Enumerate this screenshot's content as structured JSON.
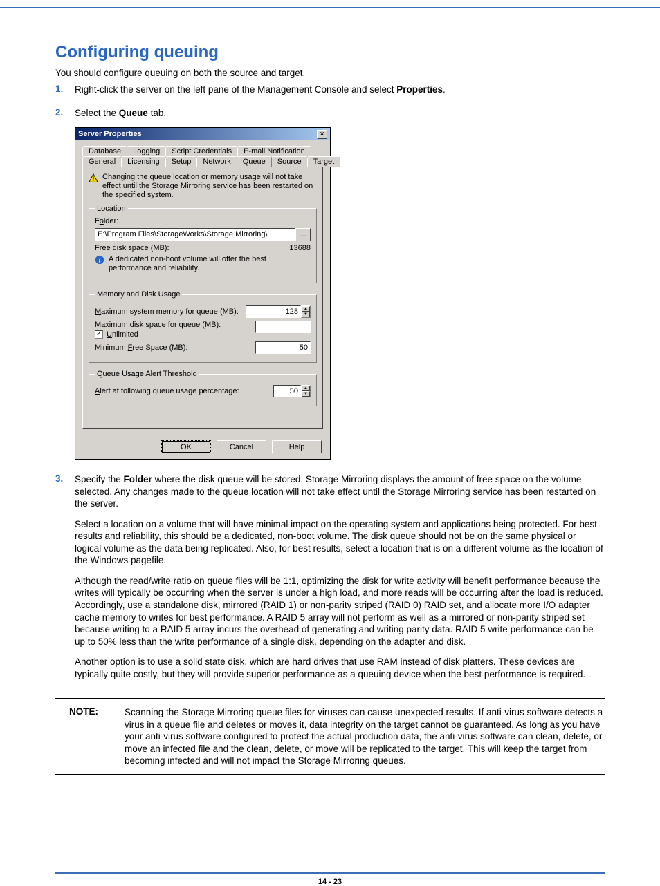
{
  "heading": "Configuring queuing",
  "intro": "You should configure queuing on both the source and target.",
  "steps": {
    "s1": {
      "prefix": "Right-click the server on the left pane of the Management Console and select ",
      "bold": "Properties",
      "suffix": "."
    },
    "s2": {
      "prefix": "Select the ",
      "bold": "Queue",
      "suffix": " tab."
    },
    "s3": {
      "prefix": "Specify the ",
      "bold": "Folder",
      "suffix": " where the disk queue will be stored. Storage Mirroring displays the amount of free space on the volume selected. Any changes made to the queue location will not take effect until the Storage Mirroring service has been restarted on the server.",
      "p2": "Select a location on a volume that will have minimal impact on the operating system and applications being protected. For best results and reliability, this should be a dedicated, non-boot volume. The disk queue should not be on the same physical or logical volume as the data being replicated. Also, for best results, select a location that is on a different volume as the location of the Windows pagefile.",
      "p3": "Although the read/write ratio on queue files will be 1:1, optimizing the disk for write activity will benefit performance because the writes will typically be occurring when the server is under a high load, and more reads will be occurring after the load is reduced. Accordingly, use a standalone disk, mirrored (RAID 1) or non-parity striped (RAID 0) RAID set, and allocate more I/O adapter cache memory to writes for best performance. A RAID 5 array will not perform as well as a mirrored or non-parity striped set because writing to a RAID 5 array incurs the overhead of generating and writing parity data. RAID 5 write performance can be up to 50% less than the write performance of a single disk, depending on the adapter and disk.",
      "p4": "Another option is to use a solid state disk, which are hard drives that use RAM instead of disk platters. These devices are typically quite costly, but they will provide superior performance as a queuing device when the best performance is required."
    }
  },
  "dialog": {
    "title": "Server Properties",
    "tabs_row1": [
      "Database",
      "Logging",
      "Script Credentials",
      "E-mail Notification"
    ],
    "tabs_row2": [
      "General",
      "Licensing",
      "Setup",
      "Network",
      "Queue",
      "Source",
      "Target"
    ],
    "active_tab": "Queue",
    "warning": "Changing the queue location or memory usage will not take effect until the Storage Mirroring service has been restarted on the specified system.",
    "location": {
      "legend": "Location",
      "folder_label": "Folder:",
      "folder_value": "E:\\Program Files\\StorageWorks\\Storage Mirroring\\",
      "browse": "...",
      "free_space_label": "Free disk space (MB):",
      "free_space_value": "13688",
      "info": "A dedicated non-boot volume will offer the best performance and reliability."
    },
    "memdisk": {
      "legend": "Memory and Disk Usage",
      "max_mem_label": "Maximum system memory for queue (MB):",
      "max_mem_value": "128",
      "max_disk_label": "Maximum disk space for queue (MB):",
      "unlimited_label": "Unlimited",
      "unlimited_checked": true,
      "min_free_label": "Minimum Free Space (MB):",
      "min_free_value": "50"
    },
    "threshold": {
      "legend": "Queue Usage Alert Threshold",
      "alert_label": "Alert at following queue usage percentage:",
      "alert_value": "50"
    },
    "buttons": {
      "ok": "OK",
      "cancel": "Cancel",
      "help": "Help"
    }
  },
  "note": {
    "label": "NOTE:",
    "text": "Scanning the Storage Mirroring queue files for viruses can cause unexpected results. If anti-virus software detects a virus in a queue file and deletes or moves it, data integrity on the target cannot be guaranteed. As long as you have your anti-virus software configured to protect the actual production data, the anti-virus software can clean, delete, or move an infected file and the clean, delete, or move will be replicated to the target. This will keep the target from becoming infected and will not impact the Storage Mirroring queues."
  },
  "footer": "14 - 23"
}
